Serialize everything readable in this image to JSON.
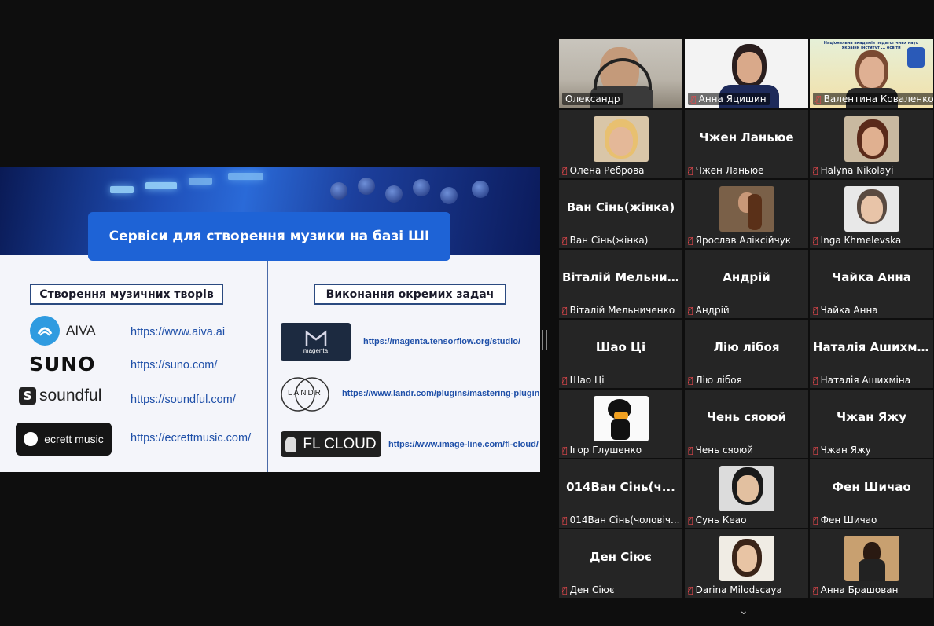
{
  "slide": {
    "title": "Сервіси для створення музики на базі ШІ",
    "left_heading": "Створення музичних творів",
    "right_heading": "Виконання окремих задач",
    "left_services": [
      {
        "logo_text": "AIVA",
        "logo_icon": "aiva-logo",
        "url": "https://www.aiva.ai"
      },
      {
        "logo_text": "SUNO",
        "logo_icon": "suno-logo",
        "url": "https://suno.com/"
      },
      {
        "logo_text": "soundful",
        "logo_icon": "soundful-logo",
        "url": "https://soundful.com/"
      },
      {
        "logo_text": "ecrett music",
        "logo_icon": "ecrett-logo",
        "url": "https://ecrettmusic.com/"
      }
    ],
    "right_services": [
      {
        "logo_text": "magenta",
        "logo_icon": "magenta-logo",
        "url": "https://magenta.tensorflow.org/studio/"
      },
      {
        "logo_text": "LANDR",
        "logo_icon": "landr-logo",
        "url": "https://www.landr.com/plugins/mastering-plugin"
      },
      {
        "logo_text": "FL CLOUD",
        "logo_icon": "fl-cloud-logo",
        "url": "https://www.image-line.com/fl-cloud/"
      }
    ]
  },
  "participants": [
    {
      "label": "Олександр",
      "display": "video",
      "muted": false,
      "active": true
    },
    {
      "label": "Анна Яцишин",
      "display": "video",
      "muted": true
    },
    {
      "label": "Валентина Коваленко",
      "display": "video",
      "muted": true
    },
    {
      "label": "Олена Реброва",
      "display": "avatar",
      "muted": true
    },
    {
      "label": "Чжен Ланьюе",
      "big": "Чжен Ланьюе",
      "display": "name",
      "muted": true
    },
    {
      "label": "Halyna Nikolayi",
      "display": "avatar",
      "muted": true
    },
    {
      "label": "Ван Сінь(жінка)",
      "big": "Ван Сінь(жінка)",
      "display": "name",
      "muted": true
    },
    {
      "label": "Ярослав Аліксійчук",
      "display": "avatar",
      "muted": true
    },
    {
      "label": "Inga Khmelevska",
      "display": "avatar",
      "muted": true
    },
    {
      "label": "Віталій Мельниченко",
      "big": "Віталій Мельни...",
      "display": "name",
      "muted": true
    },
    {
      "label": "Андрій",
      "big": "Андрій",
      "display": "name",
      "muted": true
    },
    {
      "label": "Чайка Анна",
      "big": "Чайка Анна",
      "display": "name",
      "muted": true
    },
    {
      "label": "Шао Ці",
      "big": "Шао Ці",
      "display": "name",
      "muted": true
    },
    {
      "label": "Лію лібоя",
      "big": "Лію лібоя",
      "display": "name",
      "muted": true
    },
    {
      "label": "Наталія Ашихміна",
      "big": "Наталія Ашихм...",
      "display": "name",
      "muted": true
    },
    {
      "label": "Ігор Глушенко",
      "display": "avatar",
      "muted": true
    },
    {
      "label": "Чень сяоюй",
      "big": "Чень сяоюй",
      "display": "name",
      "muted": true
    },
    {
      "label": "Чжан Яжу",
      "big": "Чжан Яжу",
      "display": "name",
      "muted": true
    },
    {
      "label": "014Ван Сінь(чоловіч...",
      "big": "014Ван Сінь(ч...",
      "display": "name",
      "muted": true
    },
    {
      "label": "Сунь Кеао",
      "display": "avatar",
      "muted": true
    },
    {
      "label": "Фен Шичао",
      "big": "Фен Шичао",
      "display": "name",
      "muted": true
    },
    {
      "label": "Ден Сіює",
      "big": "Ден Сіює",
      "display": "name",
      "muted": true
    },
    {
      "label": "Darina Milodscaya",
      "display": "avatar",
      "muted": true
    },
    {
      "label": "Анна Брашован",
      "display": "avatar",
      "muted": true
    }
  ],
  "video3_banner": "Національна академія педагогічних наук України Інститут ... освіти",
  "colors": {
    "accent": "#1e63d6",
    "active_border": "#34c759",
    "muted": "#e5484d"
  }
}
